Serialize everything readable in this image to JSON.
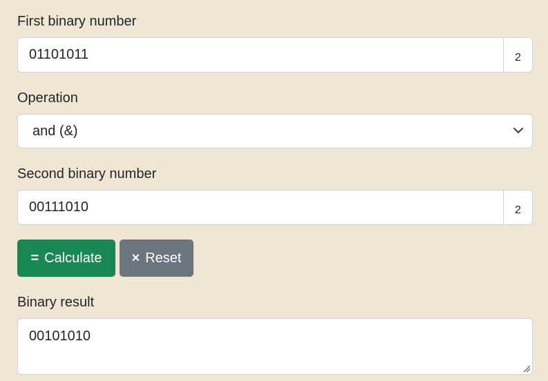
{
  "first": {
    "label": "First binary number",
    "value": "01101011",
    "base": "2"
  },
  "operation": {
    "label": "Operation",
    "selected": "and (&)"
  },
  "second": {
    "label": "Second binary number",
    "value": "00111010",
    "base": "2"
  },
  "buttons": {
    "calculate_glyph": "=",
    "calculate_label": "Calculate",
    "reset_glyph": "×",
    "reset_label": "Reset"
  },
  "result": {
    "label": "Binary result",
    "value": "00101010"
  },
  "icons": {
    "select_arrow": "chevron-down-icon",
    "resize": "resize-grip-icon",
    "reset": "x-icon"
  },
  "colors": {
    "background": "#efe7d3",
    "calculate": "#198754",
    "reset": "#6c757d"
  }
}
